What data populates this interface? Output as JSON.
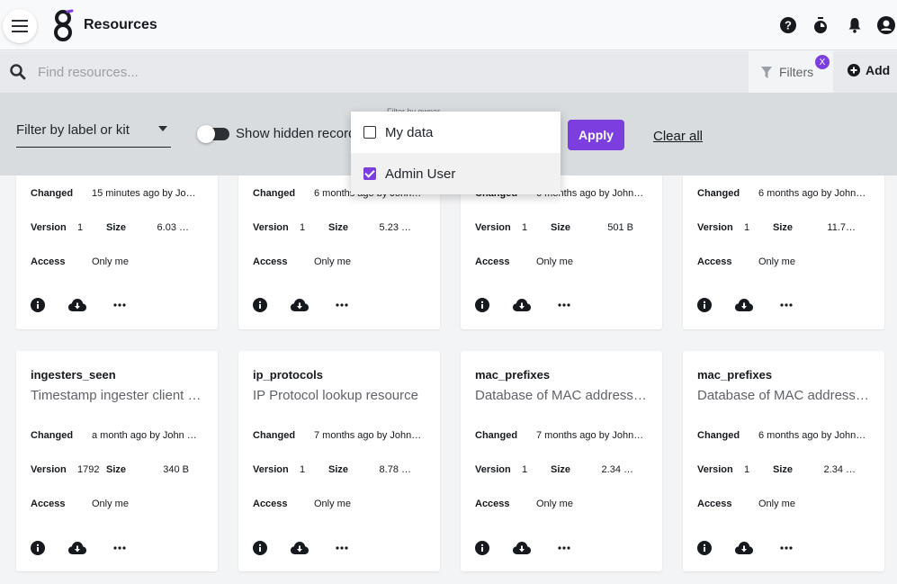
{
  "app": {
    "title": "Resources"
  },
  "topbar": {
    "icons": [
      "help-icon",
      "timer-icon",
      "bell-icon",
      "account-icon"
    ]
  },
  "search": {
    "placeholder": "Find resources...",
    "value": ""
  },
  "toolbar": {
    "filters_label": "Filters",
    "filters_badge": "X",
    "add_label": "Add"
  },
  "filter_panel": {
    "label_select": "Filter by label or kit",
    "show_hidden_label": "Show hidden records",
    "owner_label": "Filter by owner",
    "apply_label": "Apply",
    "clear_label": "Clear all"
  },
  "owner_dropdown": {
    "items": [
      {
        "label": "My data",
        "checked": false
      },
      {
        "label": "Admin User",
        "checked": true
      }
    ]
  },
  "labels": {
    "changed": "Changed",
    "version": "Version",
    "size": "Size",
    "access": "Access"
  },
  "cards_row1": [
    {
      "changed": "15 minutes ago by Jo…",
      "version": "1",
      "size": "6.03 …",
      "access": "Only me"
    },
    {
      "changed": "6 months ago by John…",
      "version": "1",
      "size": "5.23 …",
      "access": "Only me"
    },
    {
      "changed": "6 months ago by John…",
      "version": "1",
      "size": "501 B",
      "access": "Only me"
    },
    {
      "changed": "6 months ago by John…",
      "version": "1",
      "size": "11.7…",
      "access": "Only me"
    }
  ],
  "cards_row2": [
    {
      "name": "ingesters_seen",
      "description": "Timestamp ingester client …",
      "changed": "a month ago by John …",
      "version": "1792",
      "size": "340 B",
      "access": "Only me"
    },
    {
      "name": "ip_protocols",
      "description": "IP Protocol lookup resource",
      "changed": "7 months ago by John…",
      "version": "1",
      "size": "8.78 …",
      "access": "Only me"
    },
    {
      "name": "mac_prefixes",
      "description": "Database of MAC address…",
      "changed": "7 months ago by John…",
      "version": "1",
      "size": "2.34 …",
      "access": "Only me"
    },
    {
      "name": "mac_prefixes",
      "description": "Database of MAC address…",
      "changed": "6 months ago by John…",
      "version": "1",
      "size": "2.34 …",
      "access": "Only me"
    }
  ],
  "colors": {
    "accent": "#7d3ee0",
    "topbar": "#f8f9fa",
    "search": "#e7e9ec",
    "panel": "#d9dcdf",
    "page": "#f3f4f5"
  }
}
